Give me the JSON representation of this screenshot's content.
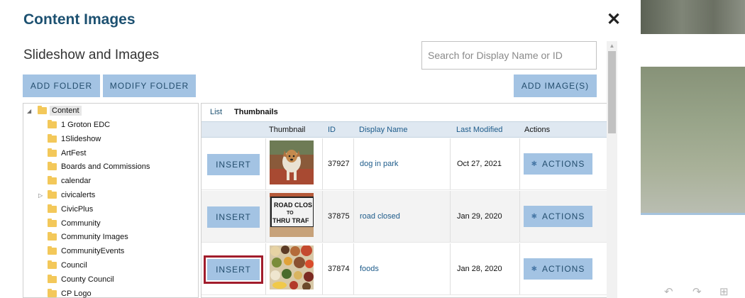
{
  "modal": {
    "title": "Content Images",
    "close_glyph": "✕",
    "subtitle": "Slideshow and Images",
    "search_placeholder": "Search for Display Name or ID",
    "buttons": {
      "add_folder": "ADD FOLDER",
      "modify_folder": "MODIFY FOLDER",
      "add_images": "ADD IMAGE(S)"
    }
  },
  "tree": {
    "root": "Content",
    "items": [
      {
        "label": "1 Groton EDC",
        "expandable": false
      },
      {
        "label": "1Slideshow",
        "expandable": false
      },
      {
        "label": "ArtFest",
        "expandable": false
      },
      {
        "label": "Boards and Commissions",
        "expandable": false
      },
      {
        "label": "calendar",
        "expandable": false
      },
      {
        "label": "civicalerts",
        "expandable": true
      },
      {
        "label": "CivicPlus",
        "expandable": false
      },
      {
        "label": "Community",
        "expandable": false
      },
      {
        "label": "Community Images",
        "expandable": false
      },
      {
        "label": "CommunityEvents",
        "expandable": false
      },
      {
        "label": "Council",
        "expandable": false
      },
      {
        "label": "County Council",
        "expandable": false
      },
      {
        "label": "CP Logo",
        "expandable": false
      }
    ]
  },
  "grid": {
    "tabs": {
      "list": "List",
      "thumbnails": "Thumbnails"
    },
    "columns": {
      "thumbnail": "Thumbnail",
      "id": "ID",
      "display_name": "Display Name",
      "last_modified": "Last Modified",
      "actions": "Actions"
    },
    "insert_label": "INSERT",
    "actions_label": "ACTIONS",
    "rows": [
      {
        "id": "37927",
        "name": "dog in park",
        "modified": "Oct 27, 2021",
        "thumb": "dog-photo"
      },
      {
        "id": "37875",
        "name": "road closed",
        "modified": "Jan 29, 2020",
        "thumb": "road-closed-sign-photo"
      },
      {
        "id": "37874",
        "name": "foods",
        "modified": "Jan 28, 2020",
        "thumb": "foods-photo"
      }
    ]
  },
  "colors": {
    "title": "#1d5171",
    "button_bg": "#a3c3e3",
    "focus_outline": "#a11d2c",
    "header_bg": "#dfe8f1"
  }
}
